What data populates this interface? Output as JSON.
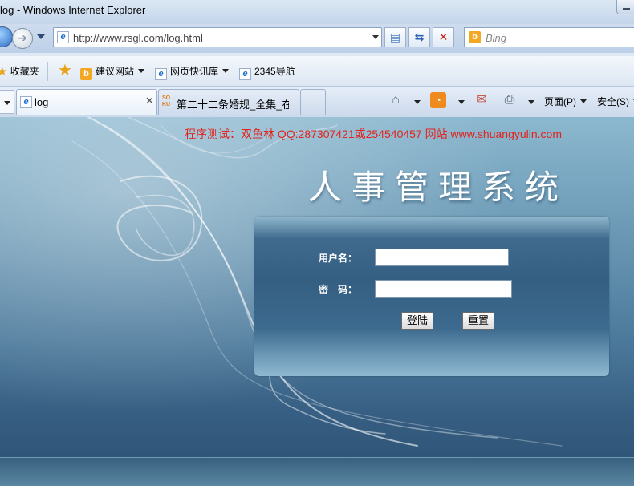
{
  "window": {
    "title": "log - Windows Internet Explorer"
  },
  "nav": {
    "url": "http://www.rsgl.com/log.html",
    "search_placeholder": "Bing"
  },
  "favorites": {
    "label": "收藏夹",
    "items": [
      "建议网站",
      "网页快讯库",
      "2345导航"
    ]
  },
  "tabs": [
    {
      "label": "log",
      "active": true
    },
    {
      "label": "第二十二条婚规_全集_在...",
      "active": false
    }
  ],
  "commands": {
    "page": "页面(P)",
    "safety": "安全(S)"
  },
  "page": {
    "credit": "程序测试：双鱼林 QQ:287307421或254540457 网站:www.shuangyulin.com",
    "system_title": "人事管理系统",
    "username_label": "用户名：",
    "password_label": "密　码：",
    "username_value": "",
    "password_value": "",
    "login_button": "登陆",
    "reset_button": "重置"
  },
  "colors": {
    "credit": "#e0241f",
    "page_bg": "#4c7a9c"
  }
}
